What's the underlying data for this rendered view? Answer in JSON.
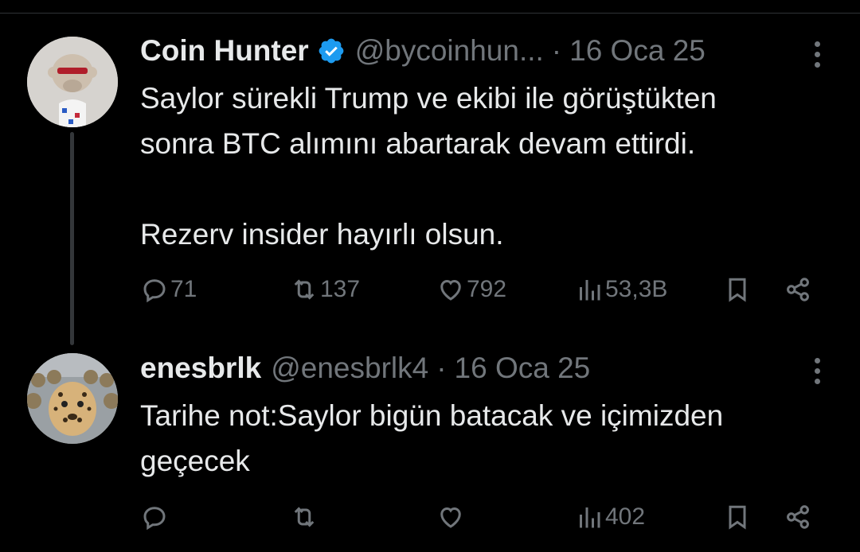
{
  "tweet1": {
    "author_name": "Coin Hunter",
    "handle": "@bycoinhun...",
    "separator": "·",
    "date": "16 Oca 25",
    "verified": true,
    "lines": [
      "Saylor sürekli Trump ve ekibi ile görüştükten",
      "sonra BTC alımını abartarak devam ettirdi."
    ],
    "line2": "Rezerv insider hayırlı olsun.",
    "stats": {
      "replies": "71",
      "reposts": "137",
      "likes": "792",
      "views": "53,3B"
    }
  },
  "tweet2": {
    "author_name": "enesbrlk",
    "handle": "@enesbrlk4",
    "separator": "·",
    "date": "16 Oca 25",
    "lines": [
      "Tarihe not:Saylor bigün batacak ve içimizden",
      "geçecek"
    ],
    "stats": {
      "views": "402"
    }
  },
  "colors": {
    "background": "#000000",
    "text": "#e7e9ea",
    "muted": "#71767b",
    "verified": "#1d9bf0"
  }
}
